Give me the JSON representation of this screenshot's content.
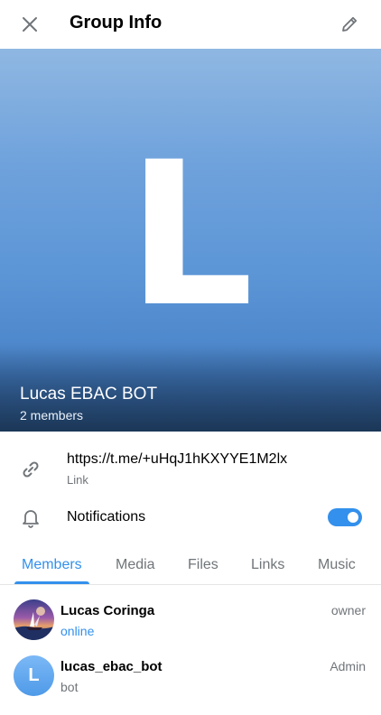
{
  "header": {
    "title": "Group Info",
    "close_icon": "close-icon",
    "edit_icon": "pencil-icon"
  },
  "profile": {
    "avatar_letter": "L",
    "name": "Lucas EBAC BOT",
    "members_count": "2 members"
  },
  "info": {
    "link_value": "https://t.me/+uHqJ1hKXYYE1M2lx",
    "link_caption": "Link",
    "link_icon": "link-icon",
    "notifications_label": "Notifications",
    "notifications_icon": "bell-icon",
    "notifications_enabled": true
  },
  "tabs": [
    {
      "label": "Members",
      "active": true
    },
    {
      "label": "Media",
      "active": false
    },
    {
      "label": "Files",
      "active": false
    },
    {
      "label": "Links",
      "active": false
    },
    {
      "label": "Music",
      "active": false
    }
  ],
  "members": [
    {
      "name": "Lucas Coringa",
      "status": "online",
      "role": "owner",
      "avatar": "photo"
    },
    {
      "name": "lucas_ebac_bot",
      "status": "bot",
      "role": "Admin",
      "avatar_letter": "L"
    }
  ],
  "colors": {
    "accent": "#3390ec",
    "secondary_text": "#707579",
    "hero_top": "#8fb7e2",
    "hero_bottom": "#25476e"
  }
}
